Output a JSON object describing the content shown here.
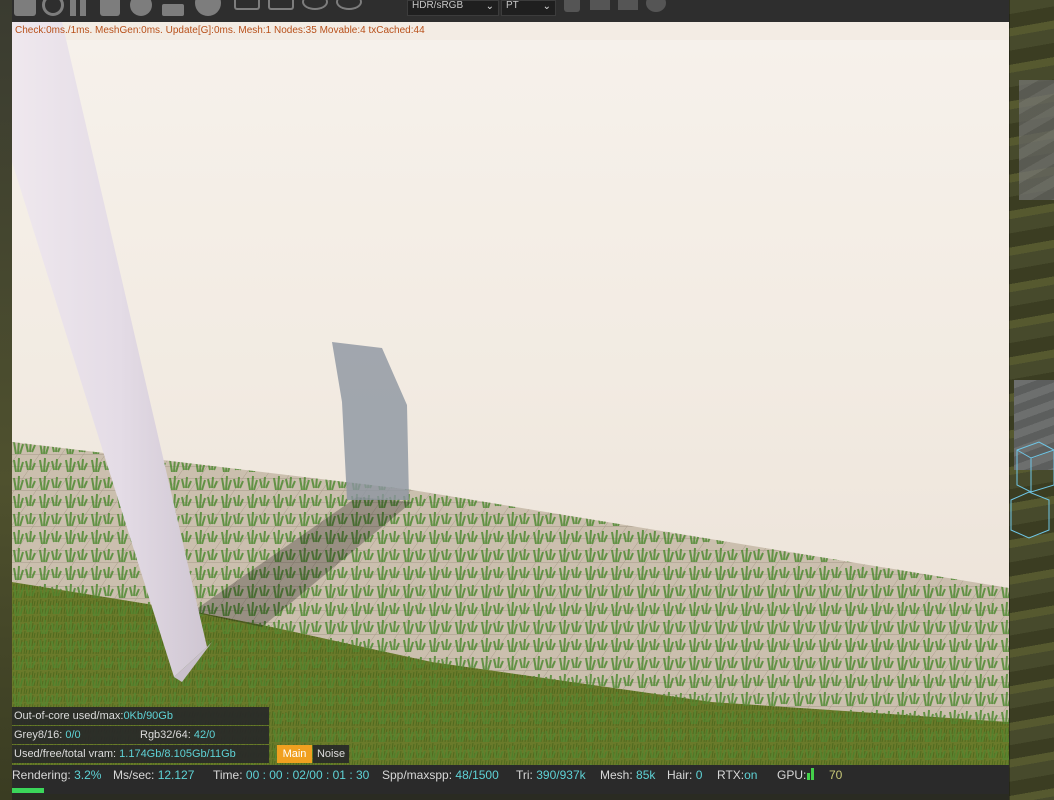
{
  "toolbar": {
    "color_space": "HDR/sRGB",
    "kernel": "PT"
  },
  "render_stats": "Check:0ms./1ms. MeshGen:0ms. Update[G]:0ms. Mesh:1 Nodes:35 Movable:4 txCached:44",
  "memory": {
    "out_of_core_label": "Out-of-core used/max:",
    "out_of_core_value": "0Kb/90Gb",
    "grey_label": "Grey8/16:",
    "grey_value": "0/0",
    "rgb_label": "Rgb32/64:",
    "rgb_value": "42/0",
    "vram_label": "Used/free/total vram:",
    "vram_value": "1.174Gb/8.105Gb/11Gb"
  },
  "tabs": {
    "main": "Main",
    "noise": "Noise"
  },
  "status": {
    "rendering_label": "Rendering:",
    "rendering_value": "3.2%",
    "ms_label": "Ms/sec:",
    "ms_value": "12.127",
    "time_label": "Time:",
    "time_value": "00 : 00 : 02/00 : 01 : 30",
    "spp_label": "Spp/maxspp:",
    "spp_value": "48/1500",
    "tri_label": "Tri:",
    "tri_value": "390/937k",
    "mesh_label": "Mesh:",
    "mesh_value": "85k",
    "hair_label": "Hair:",
    "hair_value": "0",
    "rtx_label": "RTX:",
    "rtx_value": "on",
    "gpu_label": "GPU:",
    "gpu_value": "70"
  },
  "progress": 0.032,
  "colors": {
    "accent_tab": "#f0a020",
    "value_text": "#5ed2d6",
    "stats_text": "#b8501a",
    "progress": "#3bd65a"
  },
  "icons": [
    "render-icon",
    "refresh-icon",
    "pause-icon",
    "region-icon",
    "settings-gear-icon",
    "lock-icon",
    "sphere-icon",
    "add-icon",
    "camera-icon",
    "pin-icon",
    "location-icon",
    "cube-icon",
    "square-icon",
    "snapshot-icon",
    "circle-icon"
  ]
}
